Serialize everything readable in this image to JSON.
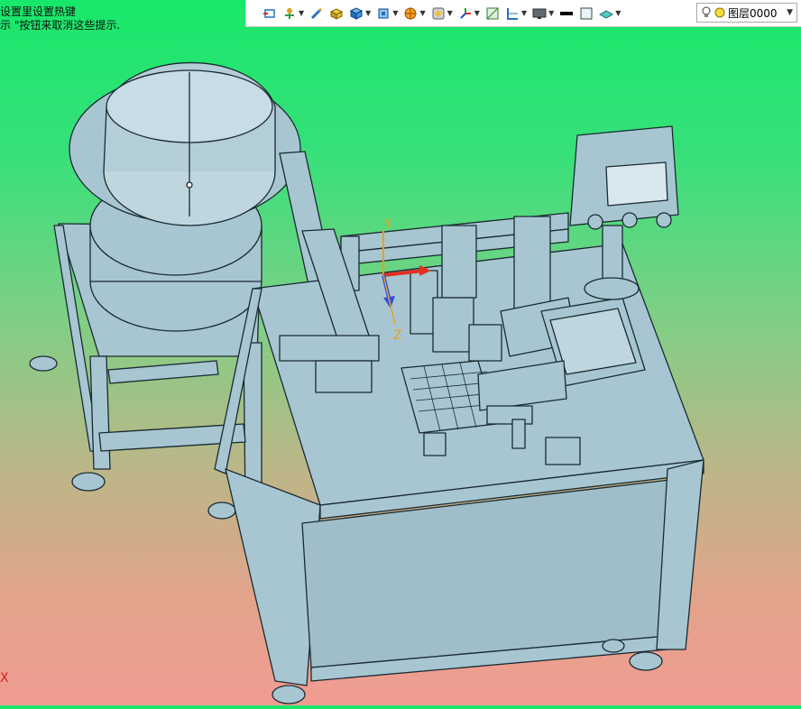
{
  "status_hint": {
    "line1": "设置里设置热键",
    "line2": "示 \"按钮来取消这些提示."
  },
  "toolbar": {
    "items": [
      {
        "icon": "view-rotate-icon"
      },
      {
        "icon": "pan-dropdown-icon",
        "dropdown": true
      },
      {
        "icon": "pen-icon"
      },
      {
        "icon": "box-yellow-icon"
      },
      {
        "icon": "box-blue-icon",
        "dropdown": true
      },
      {
        "icon": "view-cube-icon",
        "dropdown": true
      },
      {
        "icon": "render-style-icon",
        "dropdown": true
      },
      {
        "icon": "zoom-view-icon",
        "dropdown": true
      },
      {
        "icon": "triad-icon",
        "dropdown": true
      },
      {
        "icon": "section-view-icon"
      },
      {
        "icon": "split-view-icon",
        "dropdown": true
      },
      {
        "icon": "display-monitor-icon",
        "dropdown": true
      },
      {
        "icon": "color-black-swatch-icon"
      },
      {
        "icon": "color-white-swatch-icon"
      },
      {
        "icon": "appearance-icon",
        "dropdown": true
      }
    ]
  },
  "layer": {
    "label": "图层0000"
  },
  "axes": {
    "y": "Y",
    "z": "Z",
    "x": "X"
  },
  "colors": {
    "machine_fill": "#a7c6d2",
    "machine_stroke": "#1a2a30",
    "axis_x": "#e03020",
    "axis_y": "#e8a020",
    "axis_z": "#3050e0"
  }
}
